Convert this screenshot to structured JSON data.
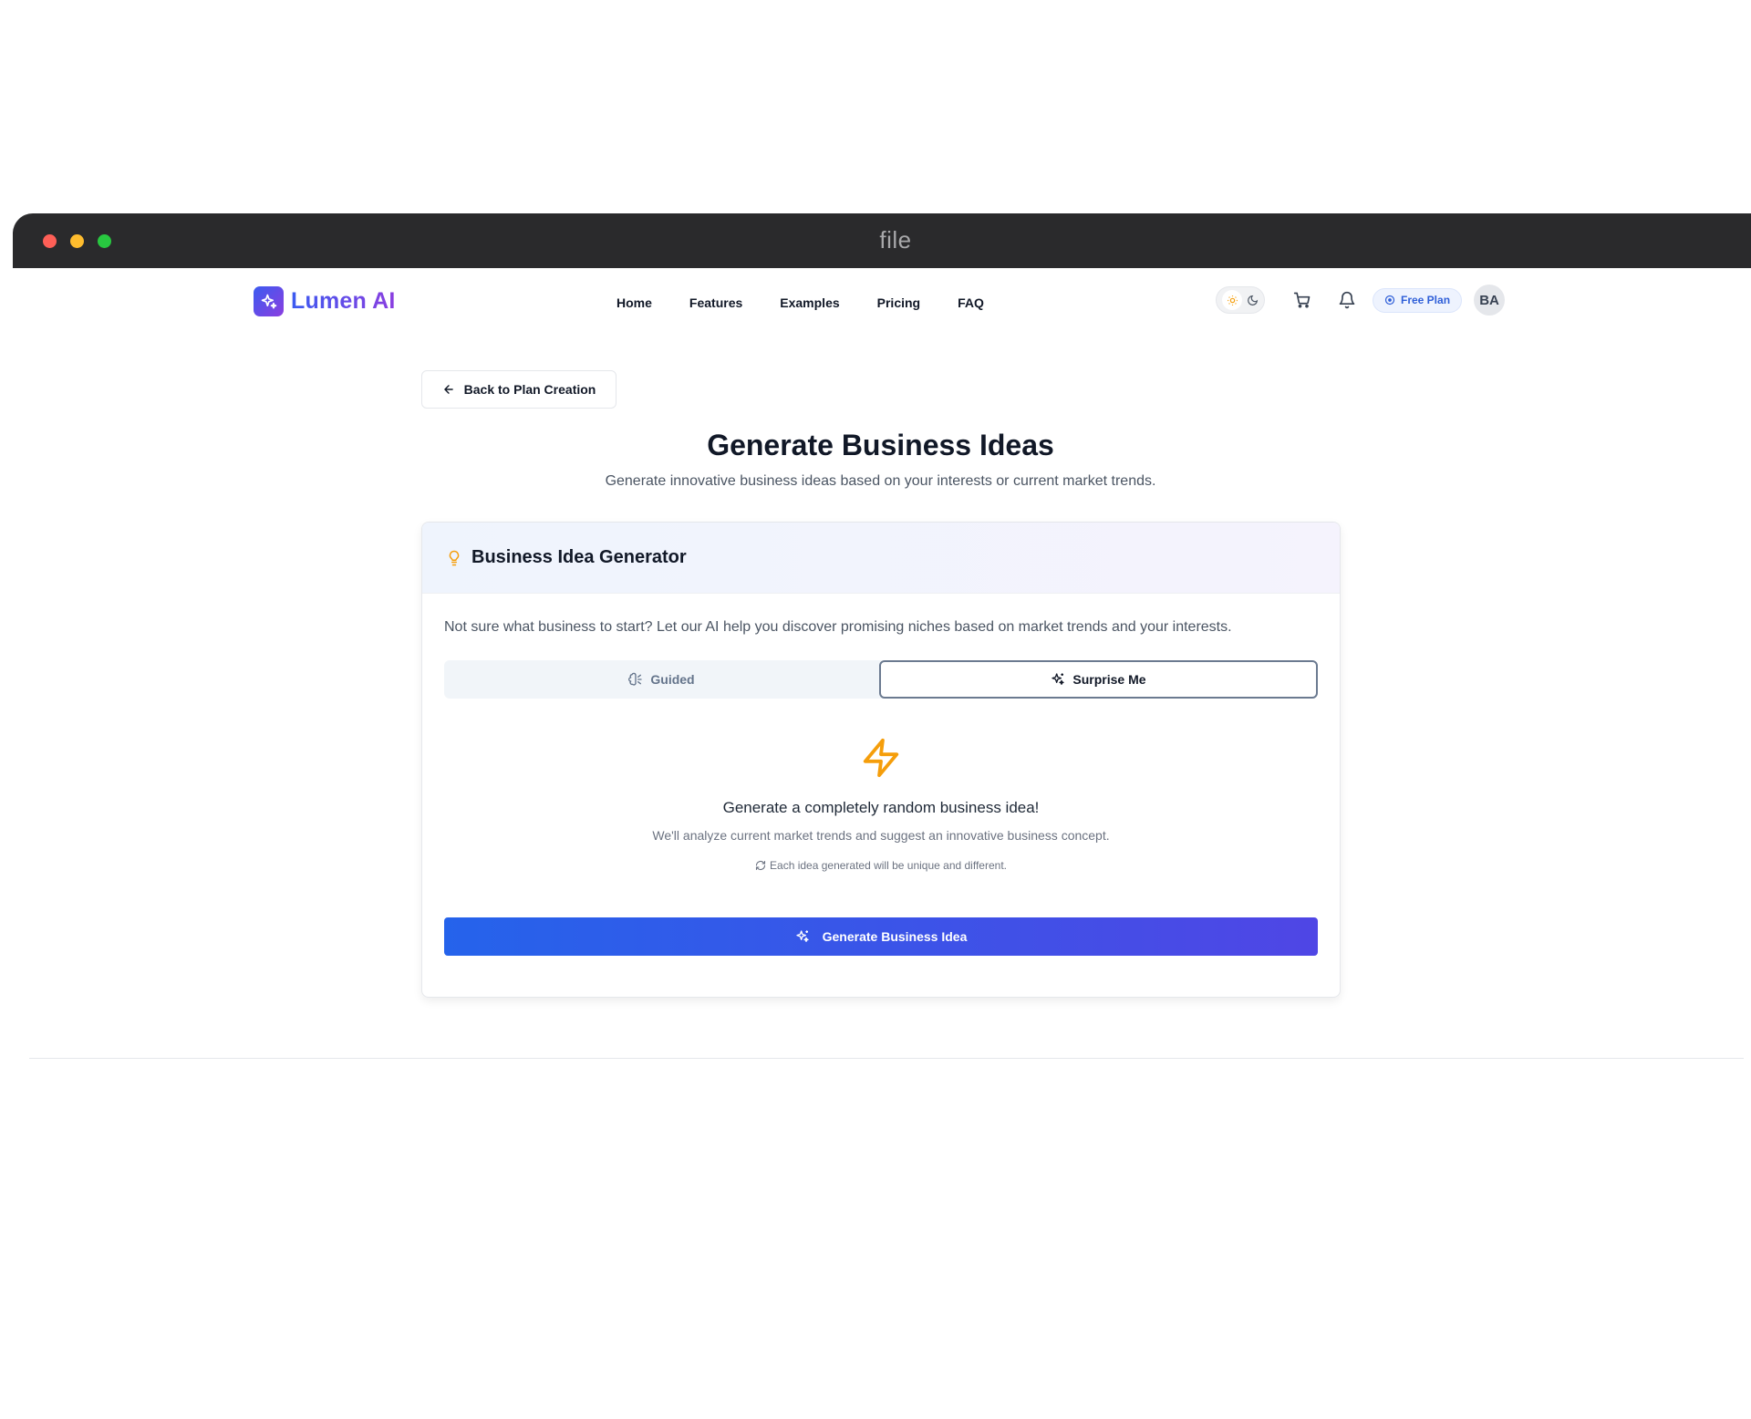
{
  "window": {
    "title": "file"
  },
  "brand": {
    "name": "Lumen AI",
    "accent_start": "#3b5bf0",
    "accent_end": "#8b3ee0"
  },
  "nav": {
    "links": [
      "Home",
      "Features",
      "Examples",
      "Pricing",
      "FAQ"
    ],
    "theme_toggle": {
      "icons": [
        "sun-icon",
        "moon-icon"
      ],
      "selected": "light"
    },
    "cart_icon": "cart-icon",
    "bell_icon": "bell-icon",
    "plan_badge": "Free Plan",
    "avatar_initials": "BA"
  },
  "back_button": {
    "label": "Back to Plan Creation"
  },
  "page": {
    "title": "Generate Business Ideas",
    "subtitle": "Generate innovative business ideas based on your interests or current market trends."
  },
  "card": {
    "title": "Business Idea Generator",
    "description": "Not sure what business to start? Let our AI help you discover promising niches based on market trends and your interests.",
    "tabs": [
      {
        "label": "Guided",
        "icon": "brain-icon",
        "active": false
      },
      {
        "label": "Surprise Me",
        "icon": "sparkles-icon",
        "active": true
      }
    ],
    "surprise": {
      "icon": "zap-icon",
      "title": "Generate a completely random business idea!",
      "subtitle": "We'll analyze current market trends and suggest an innovative business concept.",
      "note": "Each idea generated will be unique and different."
    },
    "generate_button": {
      "label": "Generate Business Idea",
      "color_start": "#2563eb",
      "color_end": "#4f46e5"
    }
  }
}
